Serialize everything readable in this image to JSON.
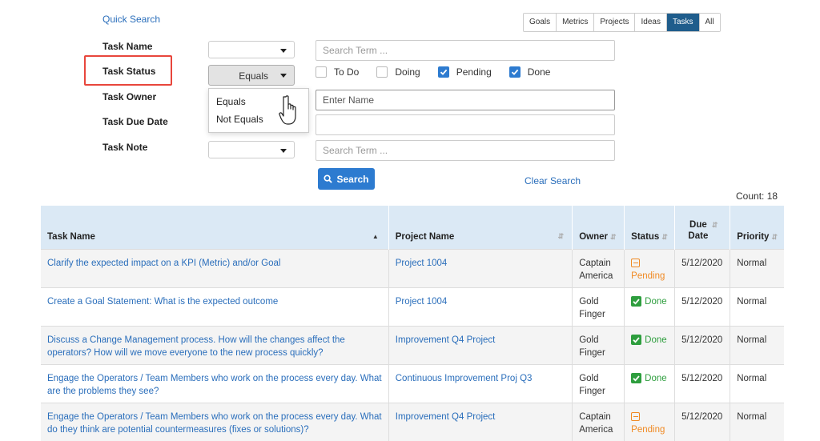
{
  "quick_search": "Quick Search",
  "tabs": [
    "Goals",
    "Metrics",
    "Projects",
    "Ideas",
    "Tasks",
    "All"
  ],
  "active_tab": "Tasks",
  "filters": {
    "task_name_label": "Task Name",
    "task_status_label": "Task Status",
    "task_owner_label": "Task Owner",
    "task_due_date_label": "Task Due Date",
    "task_note_label": "Task Note",
    "task_name_placeholder": "Search Term ...",
    "task_status_operator": "Equals",
    "task_owner_placeholder": "Enter Name",
    "task_note_placeholder": "Search Term ...",
    "status_options": [
      {
        "label": "To Do",
        "checked": false
      },
      {
        "label": "Doing",
        "checked": false
      },
      {
        "label": "Pending",
        "checked": true
      },
      {
        "label": "Done",
        "checked": true
      }
    ],
    "operator_menu": [
      "Equals",
      "Not Equals"
    ]
  },
  "search_button": "Search",
  "clear_search": "Clear Search",
  "count": "Count: 18",
  "table": {
    "headers": {
      "task_name": "Task Name",
      "project_name": "Project Name",
      "owner": "Owner",
      "status": "Status",
      "due_date": "Due Date",
      "priority": "Priority"
    },
    "rows": [
      {
        "task": "Clarify the expected impact on a KPI (Metric) and/or Goal",
        "project": "Project 1004",
        "owner": "Captain America",
        "status": "Pending",
        "due": "5/12/2020",
        "priority": "Normal"
      },
      {
        "task": "Create a Goal Statement: What is the expected outcome",
        "project": "Project 1004",
        "owner": "Gold Finger",
        "status": "Done",
        "due": "5/12/2020",
        "priority": "Normal"
      },
      {
        "task": "Discuss a Change Management process. How will the changes affect the operators? How will we move everyone to the new process quickly?",
        "project": "Improvement Q4 Project",
        "owner": "Gold Finger",
        "status": "Done",
        "due": "5/12/2020",
        "priority": "Normal"
      },
      {
        "task": "Engage the Operators / Team Members who work on the process every day. What are the problems they see?",
        "project": "Continuous Improvement Proj Q3",
        "owner": "Gold Finger",
        "status": "Done",
        "due": "5/12/2020",
        "priority": "Normal"
      },
      {
        "task": "Engage the Operators / Team Members who work on the process every day. What do they think are potential countermeasures (fixes or solutions)?",
        "project": "Improvement Q4 Project",
        "owner": "Captain America",
        "status": "Pending",
        "due": "5/12/2020",
        "priority": "Normal"
      }
    ]
  },
  "colors": {
    "accent": "#2d7bd0",
    "active_tab": "#1f5d8c",
    "header_bg": "#dbe9f5",
    "pending": "#f08a24",
    "done": "#2e9e3e",
    "highlight": "#e8463c"
  },
  "icons": {
    "search": "search-icon",
    "cursor": "hand-pointer-icon",
    "pending": "minus-square-icon",
    "done": "check-square-icon"
  }
}
